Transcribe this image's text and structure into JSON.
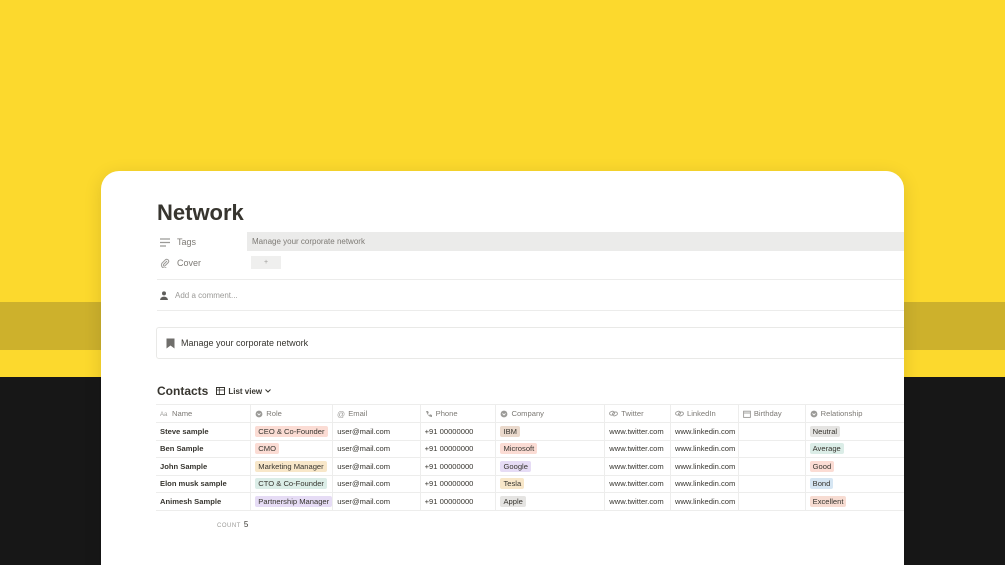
{
  "colors": {
    "background_yellow": "#fcd92d",
    "background_band": "#cdb12c",
    "background_dark": "#171717",
    "card": "#ffffff",
    "text": "#37352f",
    "muted": "#7d7a75"
  },
  "page": {
    "title": "Network",
    "properties": {
      "tags_label": "Tags",
      "tags_value": "Manage your corporate network",
      "cover_label": "Cover",
      "cover_button": "+"
    },
    "comment_placeholder": "Add a comment...",
    "callout_text": "Manage your corporate network"
  },
  "database": {
    "title": "Contacts",
    "view_label": "List view",
    "columns": [
      {
        "label": "Name",
        "icon": "text-property-icon"
      },
      {
        "label": "Role",
        "icon": "select-property-icon"
      },
      {
        "label": "Email",
        "icon": "at-sign-icon"
      },
      {
        "label": "Phone",
        "icon": "phone-icon"
      },
      {
        "label": "Company",
        "icon": "select-property-icon"
      },
      {
        "label": "Twitter",
        "icon": "link-icon"
      },
      {
        "label": "LinkedIn",
        "icon": "link-icon"
      },
      {
        "label": "Birthday",
        "icon": "calendar-icon"
      },
      {
        "label": "Relationship",
        "icon": "select-property-icon"
      }
    ],
    "rows": [
      {
        "name": "Steve sample",
        "role": {
          "label": "CEO & Co-Founder",
          "color": "#fbdcd4"
        },
        "email": "user@mail.com",
        "phone": "+91 00000000",
        "company": {
          "label": "IBM",
          "color": "#ead9cc"
        },
        "twitter": "www.twitter.com",
        "linkedin": "www.linkedin.com",
        "birthday": "",
        "relationship": {
          "label": "Neutral",
          "color": "#e5e4e2"
        }
      },
      {
        "name": "Ben Sample",
        "role": {
          "label": "CMO",
          "color": "#fbdcd4"
        },
        "email": "user@mail.com",
        "phone": "+91 00000000",
        "company": {
          "label": "Microsoft",
          "color": "#fbdcd4"
        },
        "twitter": "www.twitter.com",
        "linkedin": "www.linkedin.com",
        "birthday": "",
        "relationship": {
          "label": "Average",
          "color": "#dbede7"
        }
      },
      {
        "name": "John Sample",
        "role": {
          "label": "Marketing Manager",
          "color": "#f8e7c9"
        },
        "email": "user@mail.com",
        "phone": "+91 00000000",
        "company": {
          "label": "Google",
          "color": "#e6dcf5"
        },
        "twitter": "www.twitter.com",
        "linkedin": "www.linkedin.com",
        "birthday": "",
        "relationship": {
          "label": "Good",
          "color": "#fbdcd4"
        }
      },
      {
        "name": "Elon musk sample",
        "role": {
          "label": "CTO & Co-Founder",
          "color": "#dbede7"
        },
        "email": "user@mail.com",
        "phone": "+91 00000000",
        "company": {
          "label": "Tesla",
          "color": "#f8e7c9"
        },
        "twitter": "www.twitter.com",
        "linkedin": "www.linkedin.com",
        "birthday": "",
        "relationship": {
          "label": "Bond",
          "color": "#d6e6f3"
        }
      },
      {
        "name": "Animesh Sample",
        "role": {
          "label": "Partnership Manager",
          "color": "#e6dcf5"
        },
        "email": "user@mail.com",
        "phone": "+91 00000000",
        "company": {
          "label": "Apple",
          "color": "#e5e4e2"
        },
        "twitter": "www.twitter.com",
        "linkedin": "www.linkedin.com",
        "birthday": "",
        "relationship": {
          "label": "Excellent",
          "color": "#f7dcd2"
        }
      }
    ],
    "count_label": "COUNT",
    "count_value": "5"
  }
}
